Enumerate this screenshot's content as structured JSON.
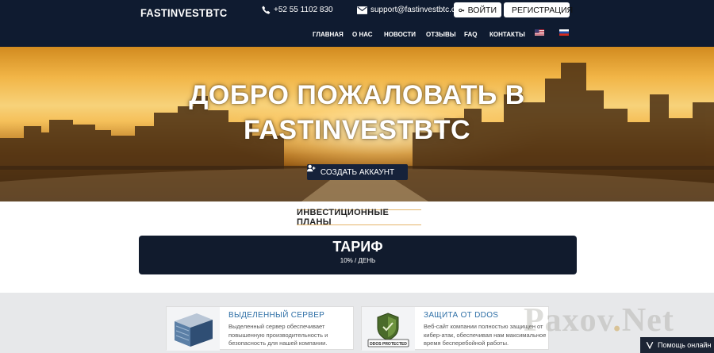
{
  "brand": {
    "name": "FASTINVESTBTC"
  },
  "header": {
    "phone": "+52 55 1102 830",
    "email": "support@fastinvestbtc.com",
    "login_label": "ВОЙТИ",
    "register_label": "РЕГИСТРАЦИЯ"
  },
  "nav": {
    "items": [
      {
        "label": "ГЛАВНАЯ"
      },
      {
        "label": "О НАС"
      },
      {
        "label": "НОВОСТИ"
      },
      {
        "label": "ОТЗЫВЫ"
      },
      {
        "label": "FAQ"
      },
      {
        "label": "КОНТАКТЫ"
      }
    ],
    "languages": [
      "en-flag-icon",
      "ru-flag-icon"
    ]
  },
  "hero": {
    "title_line1": "ДОБРО ПОЖАЛОВАТЬ В",
    "title_line2": "FASTINVESTBTC",
    "cta_label": "СОЗДАТЬ АККАУНТ"
  },
  "plans": {
    "heading": "ИНВЕСТИЦИОННЫЕ ПЛАНЫ",
    "tariff": {
      "title": "ТАРИФ",
      "rate": "10% / ДЕНЬ"
    }
  },
  "features": [
    {
      "title": "ВЫДЕЛЕННЫЙ СЕРВЕР",
      "text": "Выделенный сервер обеспечивает повышенную производительность и безопасность для нашей компании.",
      "icon": "server-image"
    },
    {
      "title": "ЗАЩИТА ОТ DDOS",
      "text": "Веб-сайт компании полностью защищен от кибер-атак, обеспечивая нам максимальное время бесперебойной работы.",
      "icon": "ddos-protected-image",
      "badge": "DDOS PROTECTED"
    }
  ],
  "watermark": {
    "part1": "Paxov",
    "dot": ".",
    "part2": "Net"
  },
  "help": {
    "label": "Помощь онлайн"
  },
  "colors": {
    "header_bg": "#0f1b30",
    "tariff_bg": "#111b2d",
    "accent_blue": "#2e6fa6",
    "plans_border": "#e5b56a"
  }
}
